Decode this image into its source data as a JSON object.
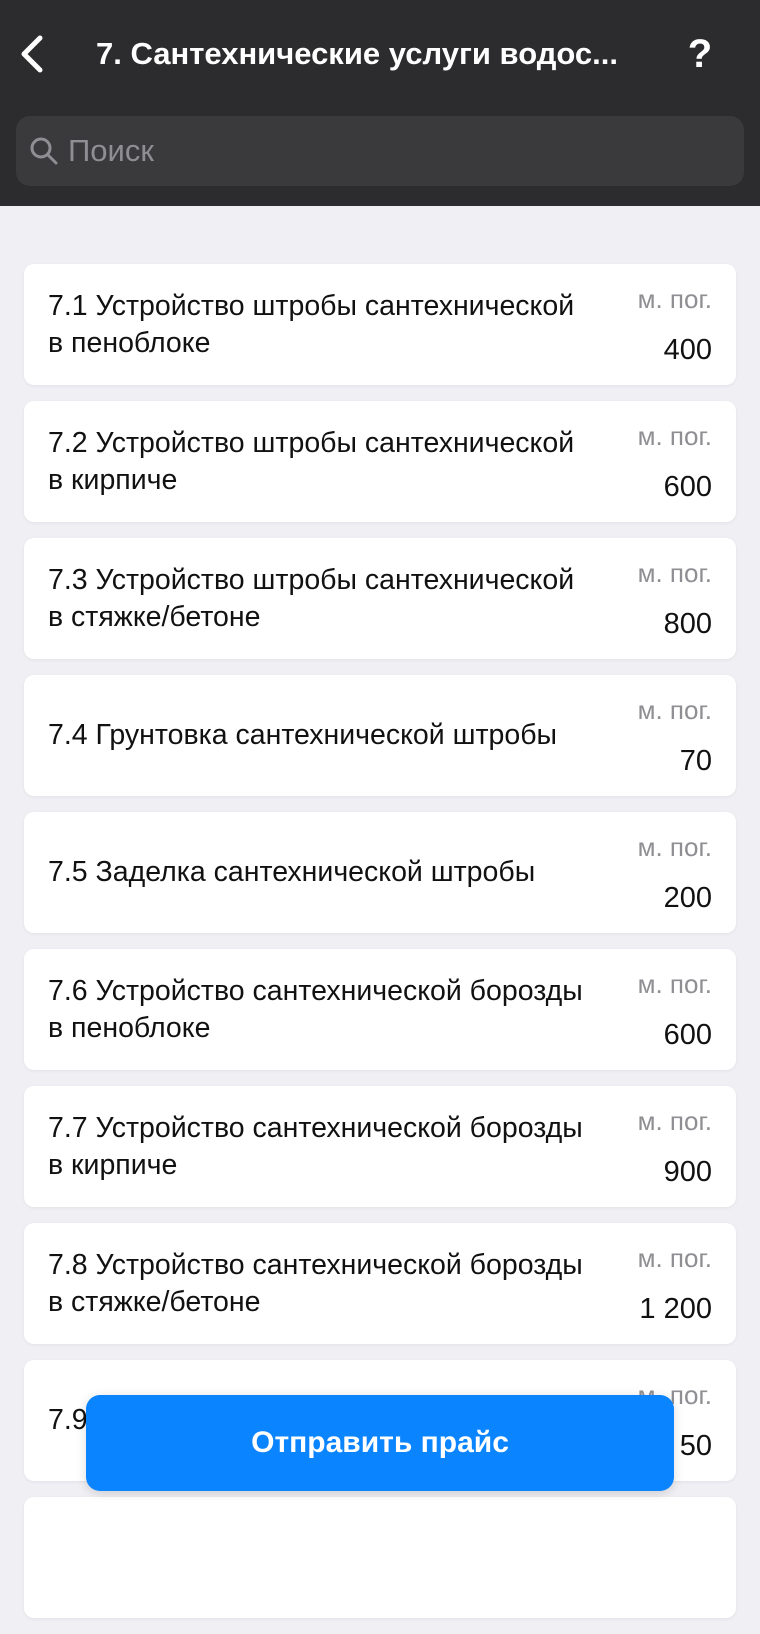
{
  "header": {
    "title": "7. Сантехнические услуги водос...",
    "back_icon": "chevron-left-icon",
    "help_label": "?"
  },
  "search": {
    "placeholder": "Поиск",
    "value": "",
    "icon": "search-icon"
  },
  "items": [
    {
      "name": "7.1 Устройство штробы сантехнической в пеноблоке",
      "unit": "м. пог.",
      "price": "400"
    },
    {
      "name": "7.2 Устройство штробы сантехнической в кирпиче",
      "unit": "м. пог.",
      "price": "600"
    },
    {
      "name": "7.3 Устройство штробы сантехнической в стяжке/бетоне",
      "unit": "м. пог.",
      "price": "800"
    },
    {
      "name": "7.4 Грунтовка сантехнической штробы",
      "unit": "м. пог.",
      "price": "70"
    },
    {
      "name": "7.5 Заделка сантехнической штробы",
      "unit": "м. пог.",
      "price": "200"
    },
    {
      "name": "7.6 Устройство сантехнической борозды в пеноблоке",
      "unit": "м. пог.",
      "price": "600"
    },
    {
      "name": "7.7 Устройство сантехнической борозды в кирпиче",
      "unit": "м. пог.",
      "price": "900"
    },
    {
      "name": "7.8 Устройство сантехнической борозды в стяжке/бетоне",
      "unit": "м. пог.",
      "price": "1 200"
    },
    {
      "name": "7.9",
      "unit": "м. пог.",
      "price": "50"
    },
    {
      "name": "",
      "unit": "",
      "price": ""
    }
  ],
  "send_button": {
    "label": "Отправить прайс"
  },
  "colors": {
    "header_bg": "#2c2c2e",
    "page_bg": "#efeff4",
    "accent": "#0a84ff"
  }
}
